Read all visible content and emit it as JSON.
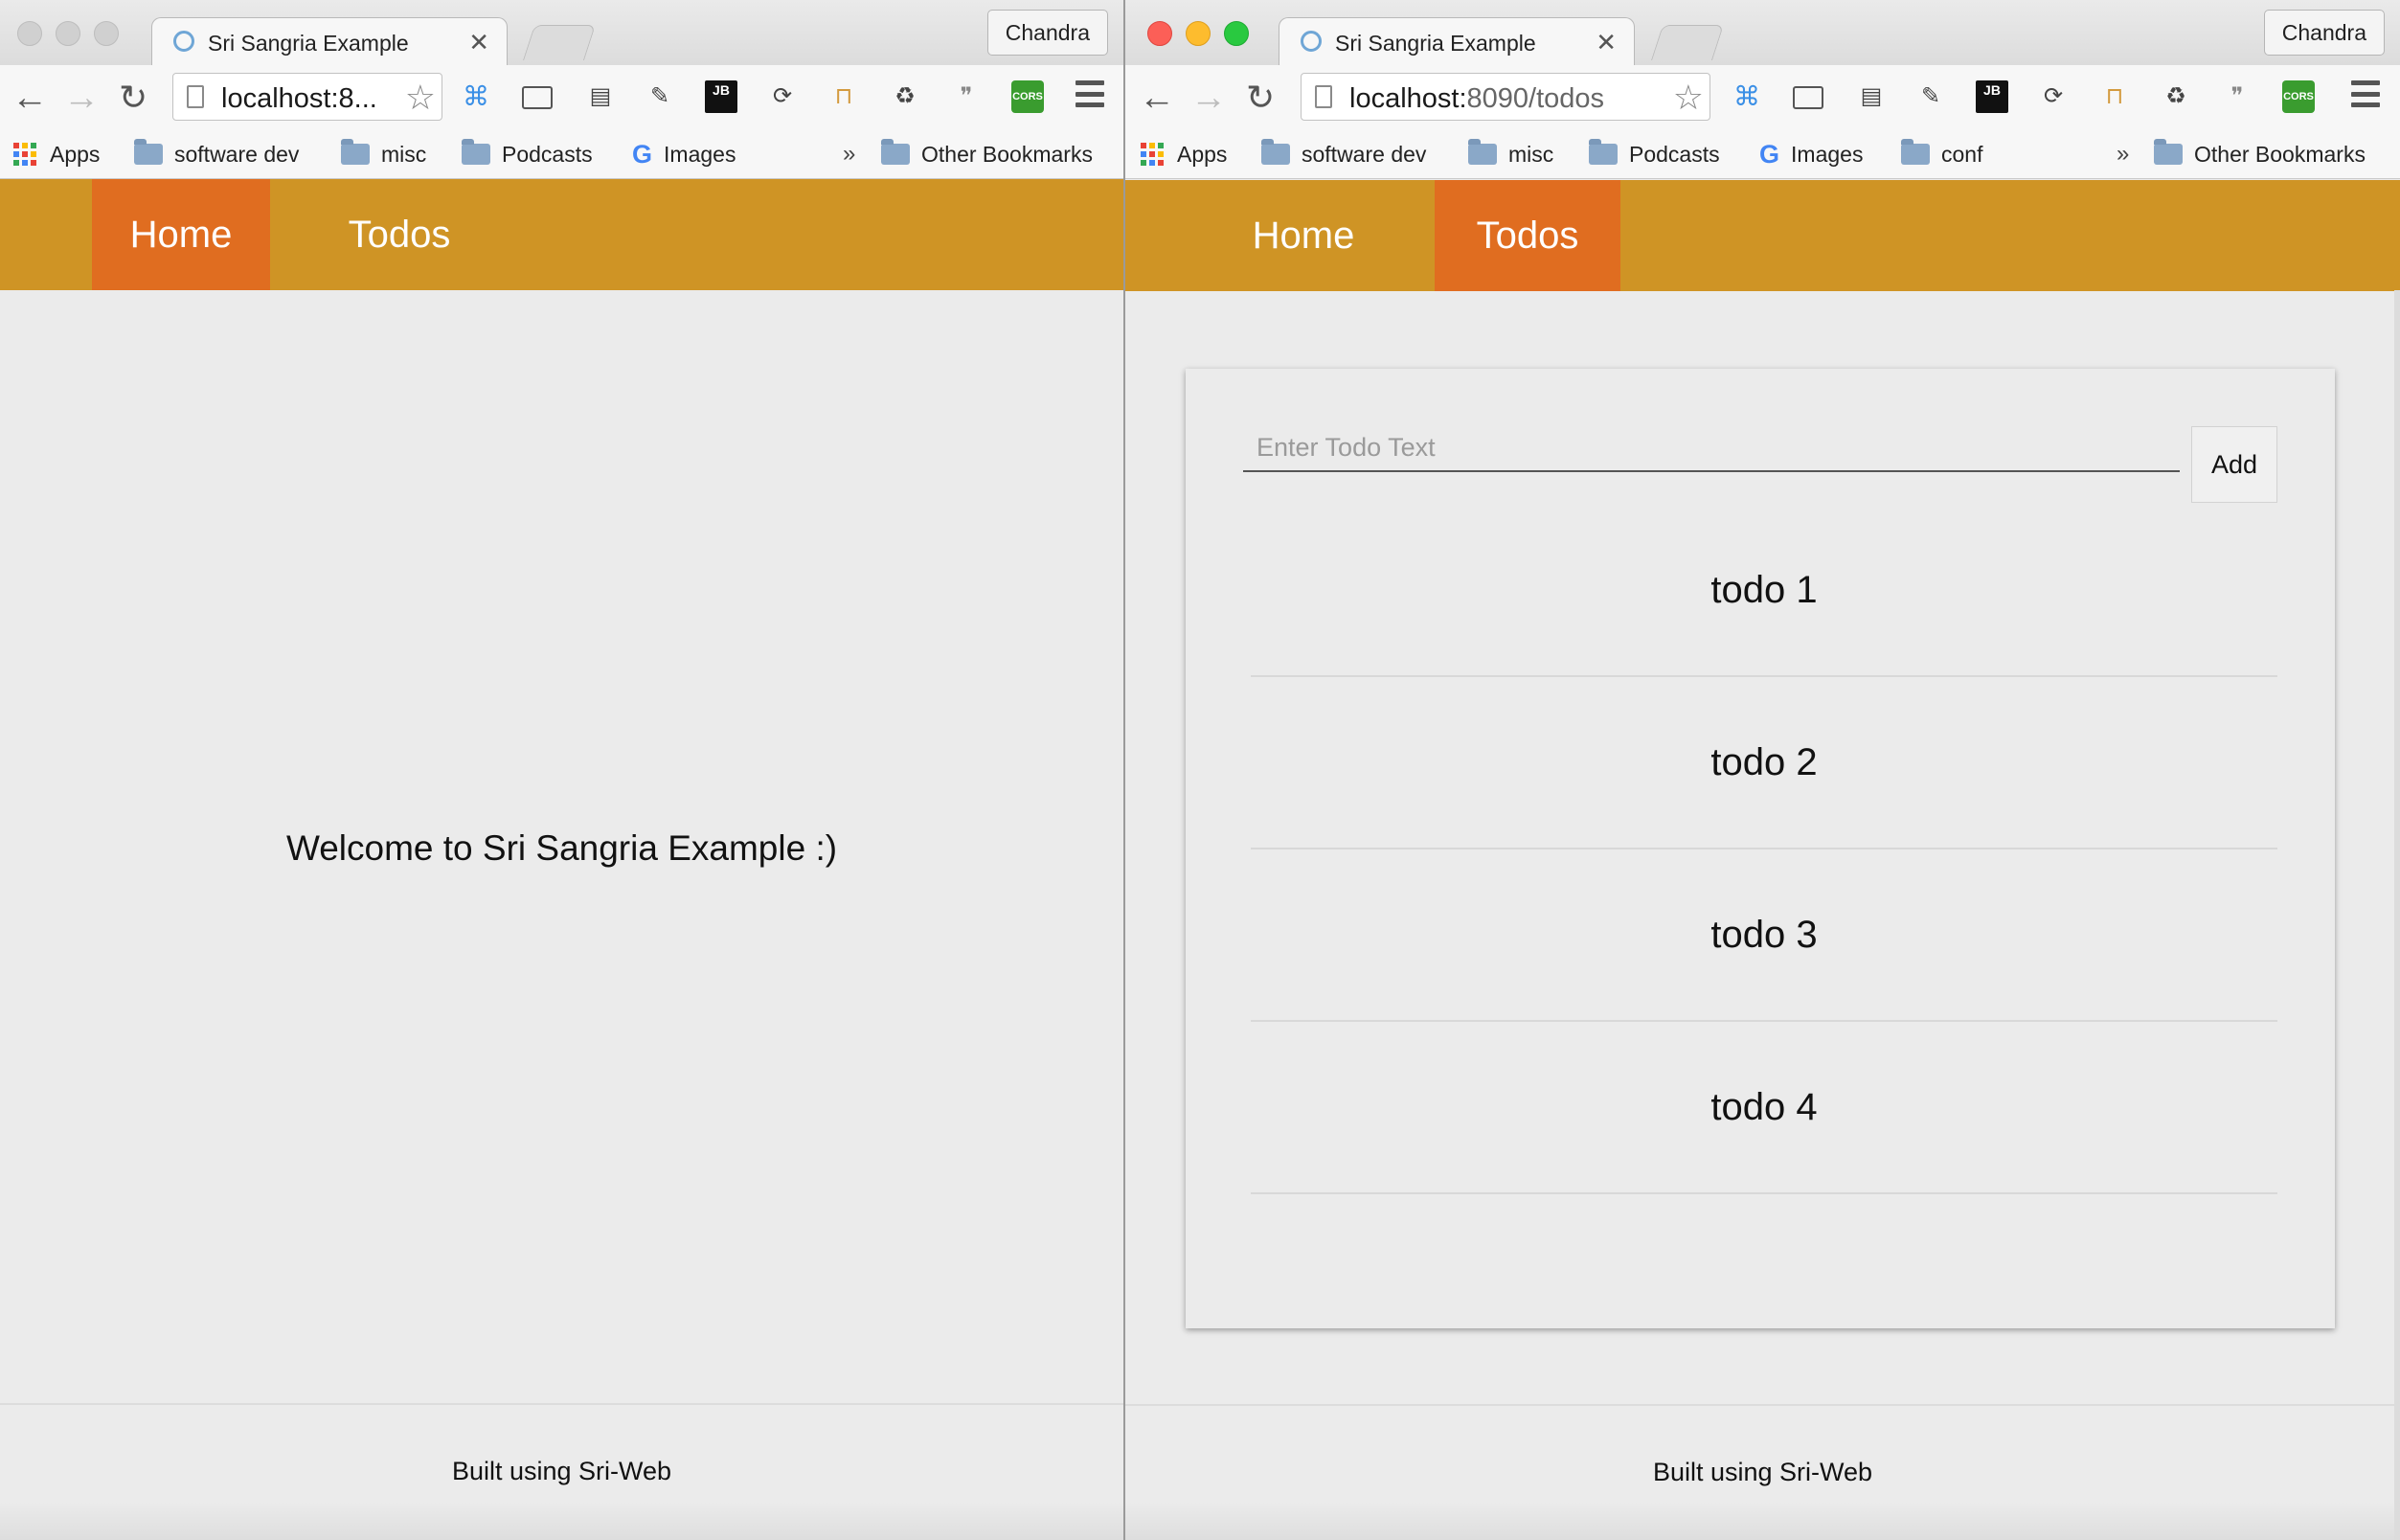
{
  "windows": [
    {
      "tab_title": "Sri Sangria Example",
      "profile": "Chandra",
      "url": "localhost:8...",
      "url_path": "",
      "bookmarks": [
        "Apps",
        "software dev",
        "misc",
        "Podcasts",
        "Images"
      ],
      "bookmarks_more": "»",
      "other_bookmarks": "Other Bookmarks",
      "nav": [
        {
          "label": "Home",
          "active": true
        },
        {
          "label": "Todos",
          "active": false
        }
      ],
      "welcome": "Welcome to Sri Sangria Example :)",
      "footer": "Built using Sri-Web"
    },
    {
      "tab_title": "Sri Sangria Example",
      "profile": "Chandra",
      "url": "localhost:",
      "url_path": "8090/todos",
      "bookmarks": [
        "Apps",
        "software dev",
        "misc",
        "Podcasts",
        "Images",
        "conf"
      ],
      "bookmarks_more": "»",
      "other_bookmarks": "Other Bookmarks",
      "nav": [
        {
          "label": "Home",
          "active": false
        },
        {
          "label": "Todos",
          "active": true
        }
      ],
      "todo_placeholder": "Enter Todo Text",
      "add_label": "Add",
      "todos": [
        "todo 1",
        "todo 2",
        "todo 3",
        "todo 4"
      ],
      "footer": "Built using Sri-Web"
    }
  ],
  "icons": {
    "back": "arrow-left-icon",
    "forward": "arrow-right-icon",
    "reload": "reload-icon",
    "star": "star-icon",
    "menu": "hamburger-menu-icon",
    "cors_badge": "CORS",
    "jb_badge": "JB"
  },
  "colors": {
    "nav_bar": "#cf9425",
    "nav_active": "#e06d20",
    "page_bg": "#ebebeb"
  }
}
